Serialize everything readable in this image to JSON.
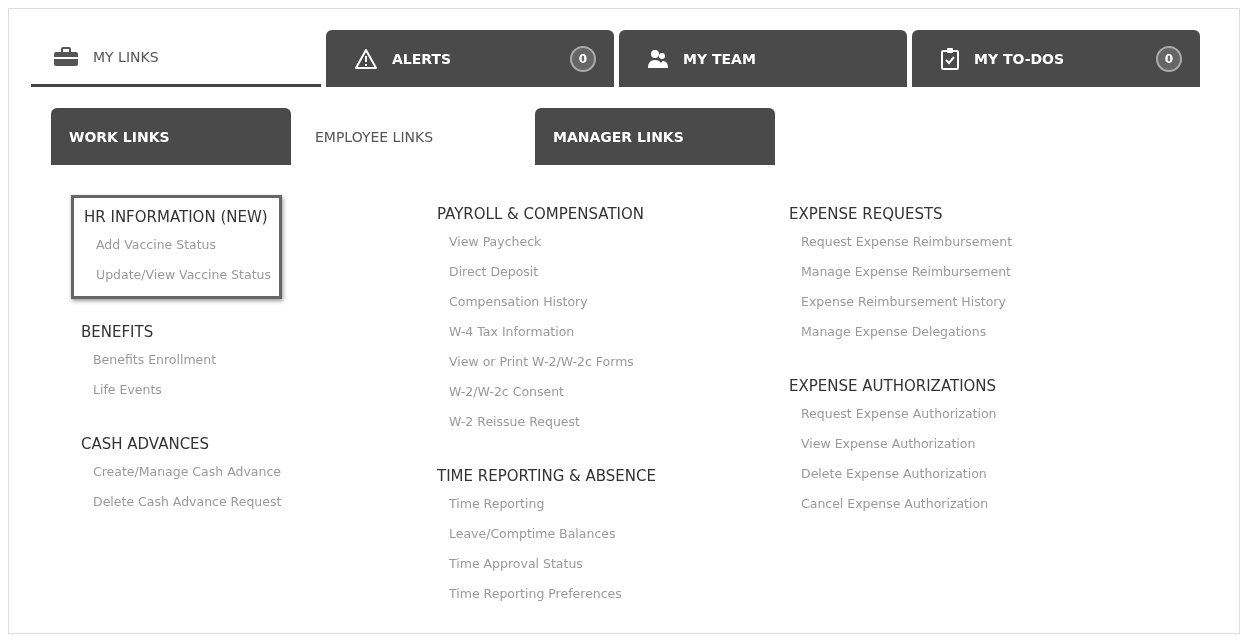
{
  "main_tabs": [
    {
      "label": "MY LINKS",
      "selected": true
    },
    {
      "label": "ALERTS",
      "badge": "0",
      "selected": false
    },
    {
      "label": "MY TEAM",
      "selected": false
    },
    {
      "label": "MY TO-DOS",
      "badge": "0",
      "selected": false
    }
  ],
  "sub_tabs": [
    {
      "label": "WORK LINKS",
      "selected": false
    },
    {
      "label": "EMPLOYEE LINKS",
      "selected": true
    },
    {
      "label": "MANAGER LINKS",
      "selected": false
    }
  ],
  "columns": [
    [
      {
        "heading": "HR INFORMATION (NEW)",
        "highlighted": true,
        "links": [
          "Add Vaccine Status",
          "Update/View Vaccine Status"
        ]
      },
      {
        "heading": "BENEFITS",
        "highlighted": false,
        "links": [
          "Benefits Enrollment",
          "Life Events"
        ]
      },
      {
        "heading": "CASH ADVANCES",
        "highlighted": false,
        "links": [
          "Create/Manage Cash Advance",
          "Delete Cash Advance Request"
        ]
      }
    ],
    [
      {
        "heading": "PAYROLL & COMPENSATION",
        "highlighted": false,
        "links": [
          "View Paycheck",
          "Direct Deposit",
          "Compensation History",
          "W-4 Tax Information",
          "View or Print W-2/W-2c Forms",
          "W-2/W-2c Consent",
          "W-2 Reissue Request"
        ]
      },
      {
        "heading": "TIME REPORTING & ABSENCE",
        "highlighted": false,
        "links": [
          "Time Reporting",
          "Leave/Comptime Balances",
          "Time Approval Status",
          "Time Reporting Preferences"
        ]
      }
    ],
    [
      {
        "heading": "EXPENSE REQUESTS",
        "highlighted": false,
        "links": [
          "Request Expense Reimbursement",
          "Manage Expense Reimbursement",
          "Expense Reimbursement History",
          "Manage Expense Delegations"
        ]
      },
      {
        "heading": "EXPENSE AUTHORIZATIONS",
        "highlighted": false,
        "links": [
          "Request Expense Authorization",
          "View Expense Authorization",
          "Delete Expense Authorization",
          "Cancel Expense Authorization"
        ]
      }
    ]
  ]
}
